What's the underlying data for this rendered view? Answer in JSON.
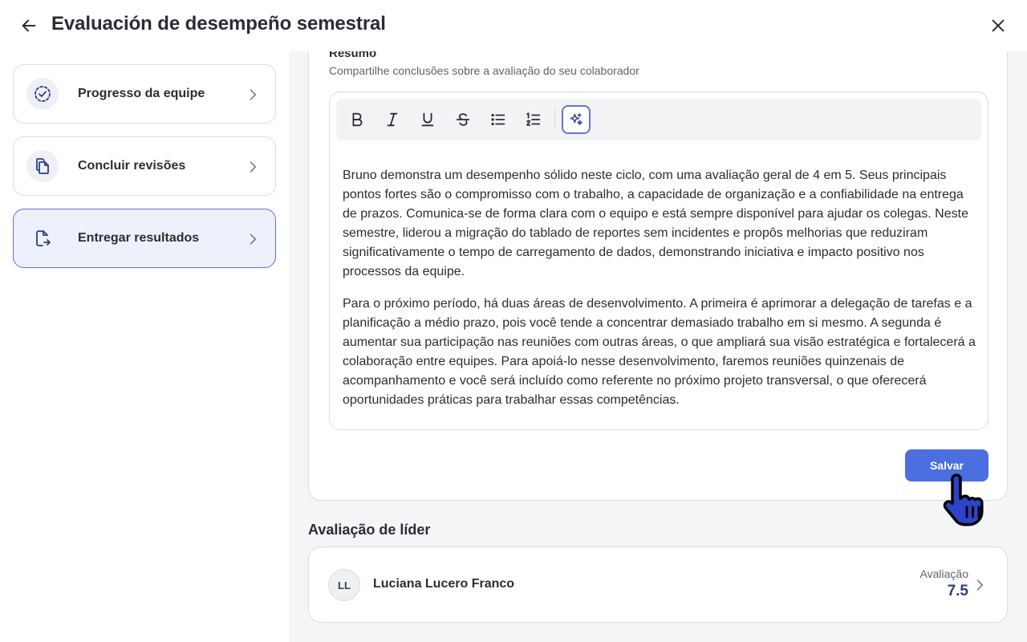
{
  "header": {
    "title": "Evaluación de desempeño semestral",
    "back_icon": "arrow-left-icon",
    "close_icon": "close-icon"
  },
  "sidebar": {
    "steps": [
      {
        "label": "Progresso da equipe",
        "icon": "progress-check-icon"
      },
      {
        "label": "Concluir revisões",
        "icon": "copy-documents-icon"
      },
      {
        "label": "Entregar resultados",
        "icon": "file-export-icon",
        "active": true
      }
    ]
  },
  "summary": {
    "title": "Resumo",
    "subtitle": "Compartilhe conclusões sobre a avaliação do seu colaborador",
    "paragraphs": [
      "Bruno demonstra um desempenho sólido neste ciclo, com uma avaliação geral de 4 em 5. Seus principais pontos fortes são o compromisso com o trabalho, a capacidade de organização e a confiabilidade na entrega de prazos. Comunica-se de forma clara com o equipo e está sempre disponível para ajudar os colegas. Neste semestre, liderou a migração do tablado de reportes sem incidentes e propôs melhorias que reduziram significativamente o tempo de carregamento de dados, demonstrando iniciativa e impacto positivo nos processos da equipe.",
      "Para o próximo período, há duas áreas de desenvolvimento. A primeira é aprimorar a delegação de tarefas e a planificação a médio prazo, pois você tende a concentrar demasiado trabalho em si mesmo. A segunda é aumentar sua participação nas reuniões com outras áreas, o que ampliará sua visão estratégica e fortalecerá a colaboração entre equipes. Para apoiá-lo nesse desenvolvimento, faremos reuniões quinzenais de acompanhamento e você será incluído como referente no próximo projeto transversal, o que oferecerá oportunidades práticas para trabalhar essas competências."
    ],
    "toolbar": [
      "bold-icon",
      "italic-icon",
      "underline-icon",
      "strikethrough-icon",
      "bullet-list-icon",
      "numbered-list-icon",
      "ai-sparkle-icon"
    ],
    "save_label": "Salvar"
  },
  "leader_section": {
    "heading": "Avaliação de líder",
    "leader": {
      "initials": "LL",
      "name": "Luciana Lucero Franco",
      "rating_label": "Avaliação",
      "rating_value": "7.5"
    }
  },
  "colors": {
    "accent": "#4b6ee0",
    "active_border": "#5a6fd8",
    "rating": "#2c3f86"
  }
}
